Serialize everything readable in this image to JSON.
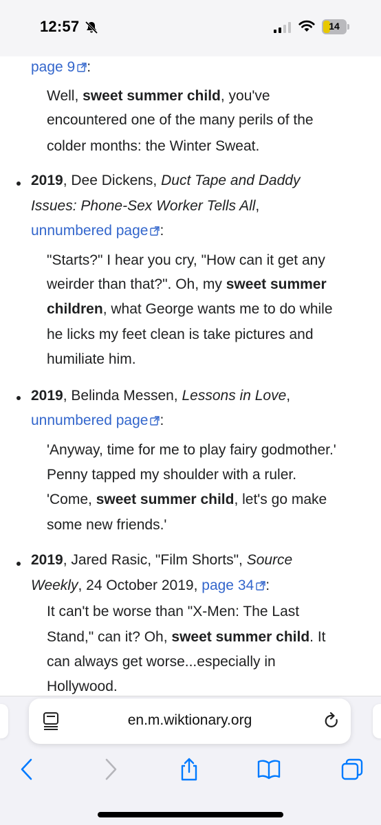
{
  "status_bar": {
    "time": "12:57",
    "battery": "14"
  },
  "entries": {
    "e0_tail": {
      "source_link": "page 9",
      "source_suffix": ":",
      "quote": {
        "l1_pre": "Well, ",
        "l1_bold": "sweet summer child",
        "l1_post": ", you've",
        "l2": "encountered one of the many perils of the",
        "l3": "colder months: the Winter Sweat."
      }
    },
    "e1": {
      "year": "2019",
      "author": ", Dee Dickens, ",
      "title_l1": "Duct Tape and Daddy",
      "title_l2": "Issues: Phone-Sex Worker Tells All",
      "title_suffix": ",",
      "source_link": "unnumbered page",
      "source_suffix": ":",
      "quote": {
        "l1": "\"Starts?\" I hear you cry, \"How can it get any",
        "l2_pre": "weirder than that?\". Oh, my ",
        "l2_bold": "sweet summer",
        "l3_bold": "children",
        "l3_post": ", what George wants me to do while",
        "l4": "he licks my feet clean is take pictures and",
        "l5": "humiliate him."
      }
    },
    "e2": {
      "year": "2019",
      "author": ", Belinda Messen, ",
      "title": "Lessons in Love",
      "title_suffix": ",",
      "source_link": "unnumbered page",
      "source_suffix": ":",
      "quote": {
        "l1": "'Anyway, time for me to play fairy godmother.'",
        "l2": "Penny tapped my shoulder with a ruler.",
        "l3_pre": "'Come, ",
        "l3_bold": "sweet summer child",
        "l3_post": ", let's go make",
        "l4": "some new friends.'"
      }
    },
    "e3": {
      "year": "2019",
      "author": ", Jared Rasic, \"Film Shorts\", ",
      "pub_l1": "Source",
      "pub_l2": "Weekly",
      "date": ", 24 October 2019, ",
      "source_link": "page 34",
      "source_suffix": ":",
      "quote": {
        "l1": "It can't be worse than \"X-Men: The Last",
        "l2_pre": "Stand,\" can it? Oh, ",
        "l2_bold": "sweet summer child",
        "l2_post": ". It",
        "l3": "can always get worse...especially in",
        "l4": "Hollywood."
      }
    }
  },
  "address_bar": {
    "url": "en.m.wiktionary.org"
  },
  "icons": {
    "bell": "bell-slash-icon",
    "reader": "reader-mode-icon",
    "reload": "reload-icon",
    "back": "chevron-left-icon",
    "forward": "chevron-right-icon",
    "share": "share-icon",
    "bookmarks": "book-icon",
    "tabs": "tabs-icon"
  },
  "colors": {
    "link": "#3366cc",
    "text": "#202122",
    "accent": "#007aff"
  }
}
